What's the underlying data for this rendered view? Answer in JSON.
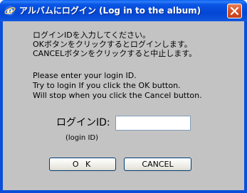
{
  "window": {
    "title": "アルバムにログイン (Log in to the album)",
    "app_icon": "ie-e-icon",
    "close_icon": "close-x-icon"
  },
  "message": {
    "ja_line1": "ログインIDを入力してください。",
    "ja_line2": "OKボタンをクリックするとログインします。",
    "ja_line3": "CANCELボタンをクリックすると中止します。",
    "en_line1": "Please enter your login ID.",
    "en_line2": "Try to login If you click the OK button.",
    "en_line3": "Will stop when you click the Cancel button."
  },
  "login": {
    "label": "ログインID:",
    "sub_label": "(login ID)",
    "value": "",
    "placeholder": ""
  },
  "buttons": {
    "ok_label": "O K",
    "cancel_label": "CANCEL"
  },
  "colors": {
    "titlebar": "#0a4fd8",
    "client_bg": "#c3c3c3",
    "close_button": "#d8542c"
  }
}
